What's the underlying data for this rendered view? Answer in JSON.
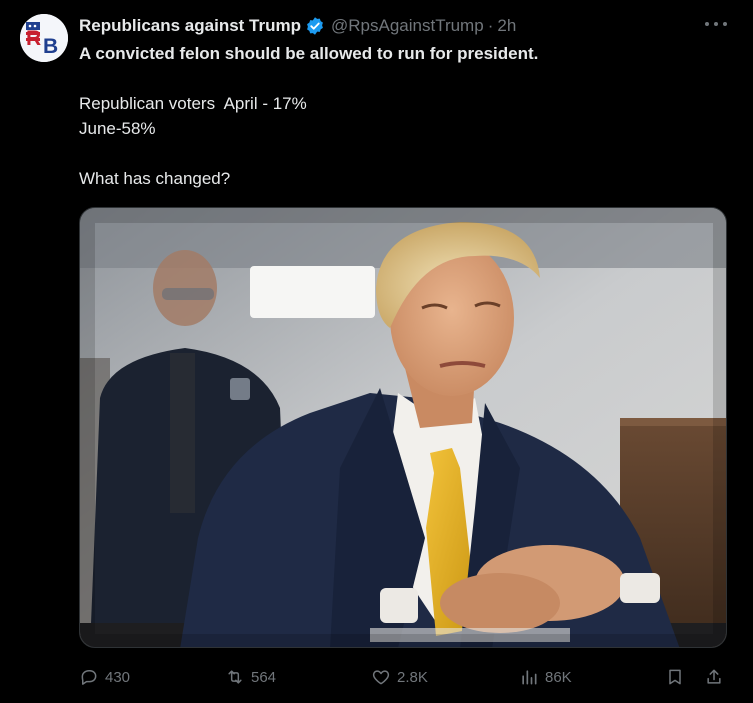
{
  "author": {
    "display_name": "Republicans against Trump",
    "handle": "@RpsAgainstTrump",
    "separator": "·",
    "time": "2h",
    "avatar_initials": "RB",
    "verified": true,
    "verified_color": "#1d9bf0"
  },
  "tweet": {
    "lines": [
      "A convicted felon should be allowed to run for president.",
      "Republican voters  April - 17%",
      "June-58%",
      "What has changed?"
    ]
  },
  "media": {
    "type": "photo",
    "alt_visible": false
  },
  "actions": {
    "reply_count": "430",
    "retweet_count": "564",
    "like_count": "2.8K",
    "views_count": "86K"
  },
  "colors": {
    "background": "#000000",
    "text": "#e7e9ea",
    "muted": "#71767b",
    "accent": "#1d9bf0"
  }
}
